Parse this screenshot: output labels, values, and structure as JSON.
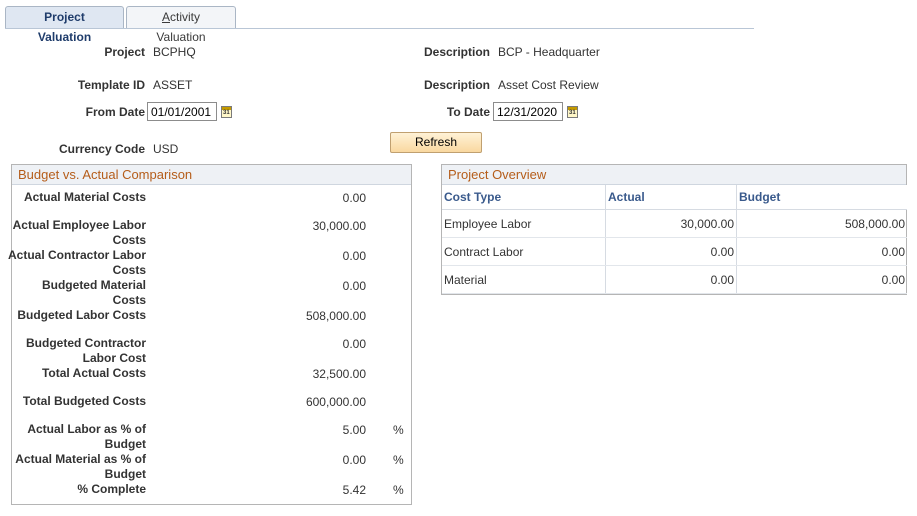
{
  "tabs": [
    {
      "label": "Project Valuation",
      "active": true
    },
    {
      "label_prefix": "",
      "label_ul": "A",
      "label_rest": "ctivity Valuation",
      "active": false
    }
  ],
  "header": {
    "project_label": "Project",
    "project_value": "BCPHQ",
    "description1_label": "Description",
    "description1_value": "BCP - Headquarter",
    "template_label": "Template ID",
    "template_value": "ASSET",
    "description2_label": "Description",
    "description2_value": "Asset Cost Review",
    "from_date_label": "From Date",
    "from_date_value": "01/01/2001",
    "to_date_label": "To Date",
    "to_date_value": "12/31/2020",
    "currency_label": "Currency Code",
    "currency_value": "USD",
    "refresh_label": "Refresh",
    "calendar_glyph": "31"
  },
  "budget_box": {
    "title": "Budget vs. Actual Comparison",
    "rows": [
      {
        "label": "Actual Material Costs",
        "value": "0.00",
        "unit": ""
      },
      {
        "label": "Actual Employee Labor Costs",
        "value": "30,000.00",
        "unit": ""
      },
      {
        "label": "Actual Contractor Labor Costs",
        "value": "0.00",
        "unit": ""
      },
      {
        "label": "Budgeted Material Costs",
        "value": "0.00",
        "unit": ""
      },
      {
        "label": "Budgeted Labor Costs",
        "value": "508,000.00",
        "unit": ""
      },
      {
        "label": "Budgeted Contractor Labor Cost",
        "value": "0.00",
        "unit": ""
      },
      {
        "label": "Total Actual Costs",
        "value": "32,500.00",
        "unit": ""
      },
      {
        "label": "Total Budgeted Costs",
        "value": "600,000.00",
        "unit": ""
      },
      {
        "label": "Actual Labor as % of Budget",
        "value": "5.00",
        "unit": "%"
      },
      {
        "label": "Actual Material as % of Budget",
        "value": "0.00",
        "unit": "%"
      },
      {
        "label": "% Complete",
        "value": "5.42",
        "unit": "%"
      }
    ]
  },
  "overview_box": {
    "title": "Project Overview",
    "columns": [
      "Cost Type",
      "Actual",
      "Budget"
    ],
    "rows": [
      {
        "cost_type": "Employee Labor",
        "actual": "30,000.00",
        "budget": "508,000.00"
      },
      {
        "cost_type": "Contract Labor",
        "actual": "0.00",
        "budget": "0.00"
      },
      {
        "cost_type": "Material",
        "actual": "0.00",
        "budget": "0.00"
      }
    ]
  }
}
